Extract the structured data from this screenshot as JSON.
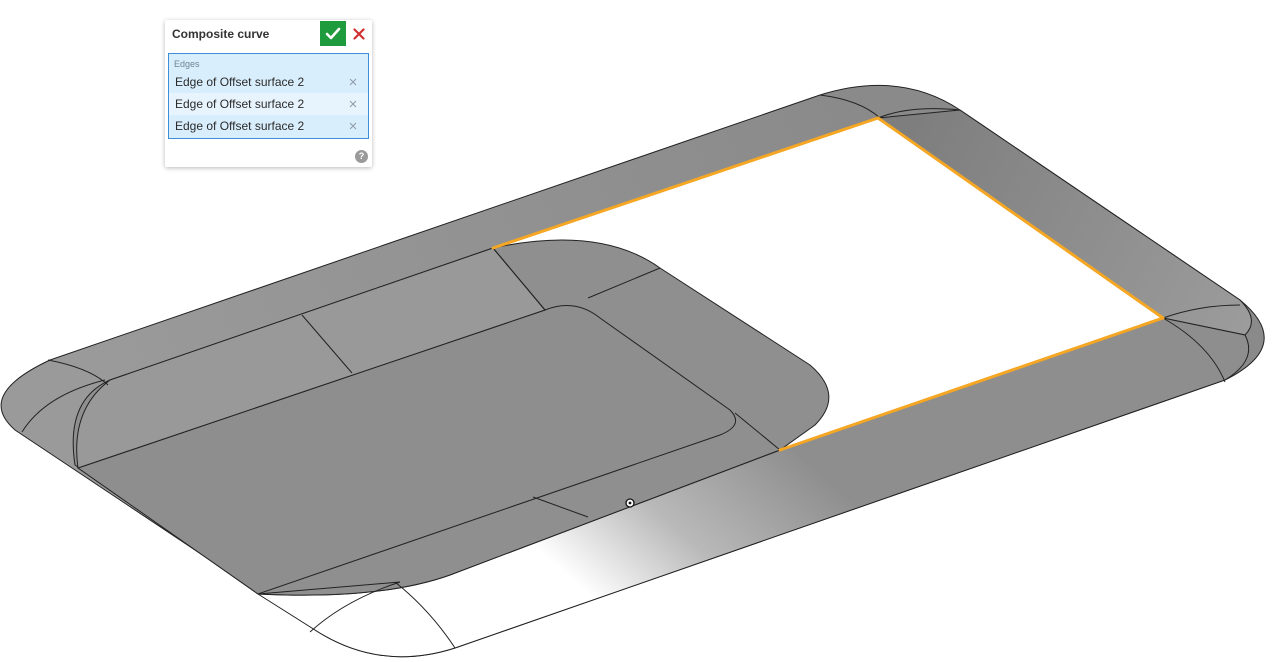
{
  "feature_dialog": {
    "title": "Composite curve",
    "accept_icon": "checkmark-icon",
    "cancel_icon": "close-x-icon",
    "accept_color": "#1e9b3c",
    "cancel_color": "#d22f2f",
    "edges_section": {
      "label": "Edges",
      "items": [
        {
          "label": "Edge of Offset surface 2",
          "remove_icon": "close-icon"
        },
        {
          "label": "Edge of Offset surface 2",
          "remove_icon": "close-icon"
        },
        {
          "label": "Edge of Offset surface 2",
          "remove_icon": "close-icon"
        }
      ]
    },
    "help_glyph": "?",
    "help_icon": "help-icon"
  },
  "viewport": {
    "model_face_color": "#8d8d8d",
    "model_edge_color": "#222222",
    "selected_edge_color": "#f5a623",
    "selection_point_icon": "target-point-icon"
  }
}
